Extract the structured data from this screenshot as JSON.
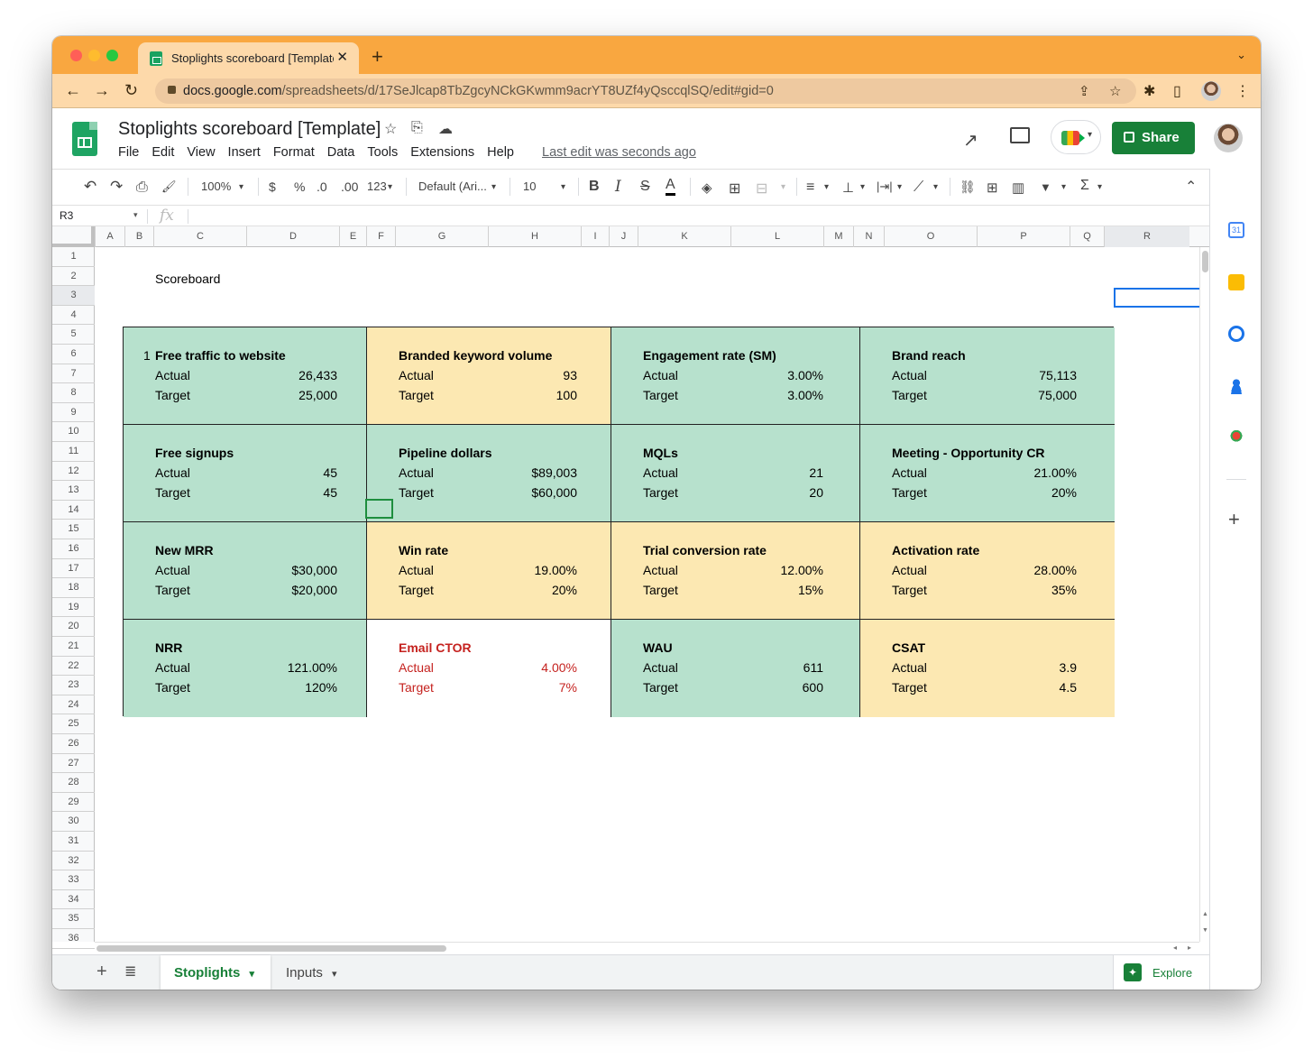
{
  "browser": {
    "tab_title": "Stoplights scoreboard [Template]",
    "close_glyph": "✕",
    "new_tab_glyph": "+",
    "tab_menu_glyph": "⌄",
    "url_host": "docs.google.com",
    "url_path": "/spreadsheets/d/17SeJlcap8TbZgcyNCkGKwmm9acrYT8UZf4yQsccqlSQ/edit#gid=0",
    "back_glyph": "←",
    "forward_glyph": "→",
    "reload_glyph": "↻",
    "share_glyph": "⇪",
    "star_glyph": "☆",
    "extensions_glyph": "✱",
    "sidebar_glyph": "▯",
    "menu_glyph": "⋮"
  },
  "doc": {
    "title": "Stoplights scoreboard [Template]",
    "star_glyph": "☆",
    "move_glyph": "⎘",
    "cloud_glyph": "☁",
    "last_edit": "Last edit was seconds ago",
    "share_label": "Share",
    "meet_caret": "▾",
    "trend_glyph": "↗"
  },
  "menu": [
    "File",
    "Edit",
    "View",
    "Insert",
    "Format",
    "Data",
    "Tools",
    "Extensions",
    "Help"
  ],
  "toolbar": {
    "undo": "↶",
    "redo": "↷",
    "print": "⎙",
    "paint": "🖌",
    "zoom": "100%",
    "currency": "$",
    "percent": "%",
    "dec_less": ".0",
    "dec_more": ".00",
    "more_formats": "123",
    "font": "Default (Ari...",
    "font_size": "10",
    "bold": "B",
    "italic": "I",
    "strike": "S",
    "text_color": "A",
    "fill": "◈",
    "borders": "⊞",
    "merge": "⊟",
    "halign": "≡",
    "valign": "⊥",
    "wrap": "|⇥|",
    "rotate": "⟋",
    "link": "⛓",
    "comment": "⊞",
    "chart": "▥",
    "filter": "▼",
    "functions": "Σ",
    "collapse": "⌃",
    "caret": "▾"
  },
  "formula_bar": {
    "namebox": "R3",
    "fx": "fx",
    "caret": "▾"
  },
  "columns": [
    "A",
    "B",
    "C",
    "D",
    "E",
    "F",
    "G",
    "H",
    "I",
    "J",
    "K",
    "L",
    "M",
    "N",
    "O",
    "P",
    "Q",
    "R"
  ],
  "rows": [
    "1",
    "2",
    "3",
    "4",
    "5",
    "6",
    "7",
    "8",
    "9",
    "10",
    "11",
    "12",
    "13",
    "14",
    "15",
    "16",
    "17",
    "18",
    "19",
    "20",
    "21",
    "22",
    "23",
    "24",
    "25",
    "26",
    "27",
    "28",
    "29",
    "30",
    "31",
    "32",
    "33",
    "34",
    "35",
    "36"
  ],
  "sheet": {
    "heading": "Scoreboard",
    "first_index": "1",
    "cards": [
      {
        "title": "Free traffic to website",
        "actual_label": "Actual",
        "actual": "26,433",
        "target_label": "Target",
        "target": "25,000",
        "status": "green"
      },
      {
        "title": "Branded keyword volume",
        "actual_label": "Actual",
        "actual": "93",
        "target_label": "Target",
        "target": "100",
        "status": "amber"
      },
      {
        "title": "Engagement rate (SM)",
        "actual_label": "Actual",
        "actual": "3.00%",
        "target_label": "Target",
        "target": "3.00%",
        "status": "green"
      },
      {
        "title": "Brand reach",
        "actual_label": "Actual",
        "actual": "75,113",
        "target_label": "Target",
        "target": "75,000",
        "status": "green"
      },
      {
        "title": "Free signups",
        "actual_label": "Actual",
        "actual": "45",
        "target_label": "Target",
        "target": "45",
        "status": "green"
      },
      {
        "title": "Pipeline dollars",
        "actual_label": "Actual",
        "actual": "$89,003",
        "target_label": "Target",
        "target": "$60,000",
        "status": "green"
      },
      {
        "title": "MQLs",
        "actual_label": "Actual",
        "actual": "21",
        "target_label": "Target",
        "target": "20",
        "status": "green"
      },
      {
        "title": "Meeting - Opportunity CR",
        "actual_label": "Actual",
        "actual": "21.00%",
        "target_label": "Target",
        "target": "20%",
        "status": "green"
      },
      {
        "title": "New MRR",
        "actual_label": "Actual",
        "actual": "$30,000",
        "target_label": "Target",
        "target": "$20,000",
        "status": "green"
      },
      {
        "title": "Win rate",
        "actual_label": "Actual",
        "actual": "19.00%",
        "target_label": "Target",
        "target": "20%",
        "status": "amber"
      },
      {
        "title": "Trial conversion rate",
        "actual_label": "Actual",
        "actual": "12.00%",
        "target_label": "Target",
        "target": "15%",
        "status": "amber"
      },
      {
        "title": "Activation rate",
        "actual_label": "Actual",
        "actual": "28.00%",
        "target_label": "Target",
        "target": "35%",
        "status": "amber"
      },
      {
        "title": "NRR",
        "actual_label": "Actual",
        "actual": "121.00%",
        "target_label": "Target",
        "target": "120%",
        "status": "green"
      },
      {
        "title": "Email CTOR",
        "actual_label": "Actual",
        "actual": "4.00%",
        "target_label": "Target",
        "target": "7%",
        "status": "red"
      },
      {
        "title": "WAU",
        "actual_label": "Actual",
        "actual": "611",
        "target_label": "Target",
        "target": "600",
        "status": "green"
      },
      {
        "title": "CSAT",
        "actual_label": "Actual",
        "actual": "3.9",
        "target_label": "Target",
        "target": "4.5",
        "status": "amber"
      }
    ]
  },
  "tabs": {
    "add": "+",
    "all": "≣",
    "stoplights": "Stoplights",
    "inputs": "Inputs",
    "caret": "▾",
    "explore": "Explore",
    "explore_glyph": "✦"
  },
  "side": {
    "add_glyph": "+",
    "expand_glyph": "›",
    "calendar_day": "31"
  },
  "colors": {
    "green": "#b7e1cd",
    "amber": "#fce8b2",
    "red": "#c5221f",
    "sheets_green": "#188038",
    "chrome_orange": "#f9a740"
  }
}
